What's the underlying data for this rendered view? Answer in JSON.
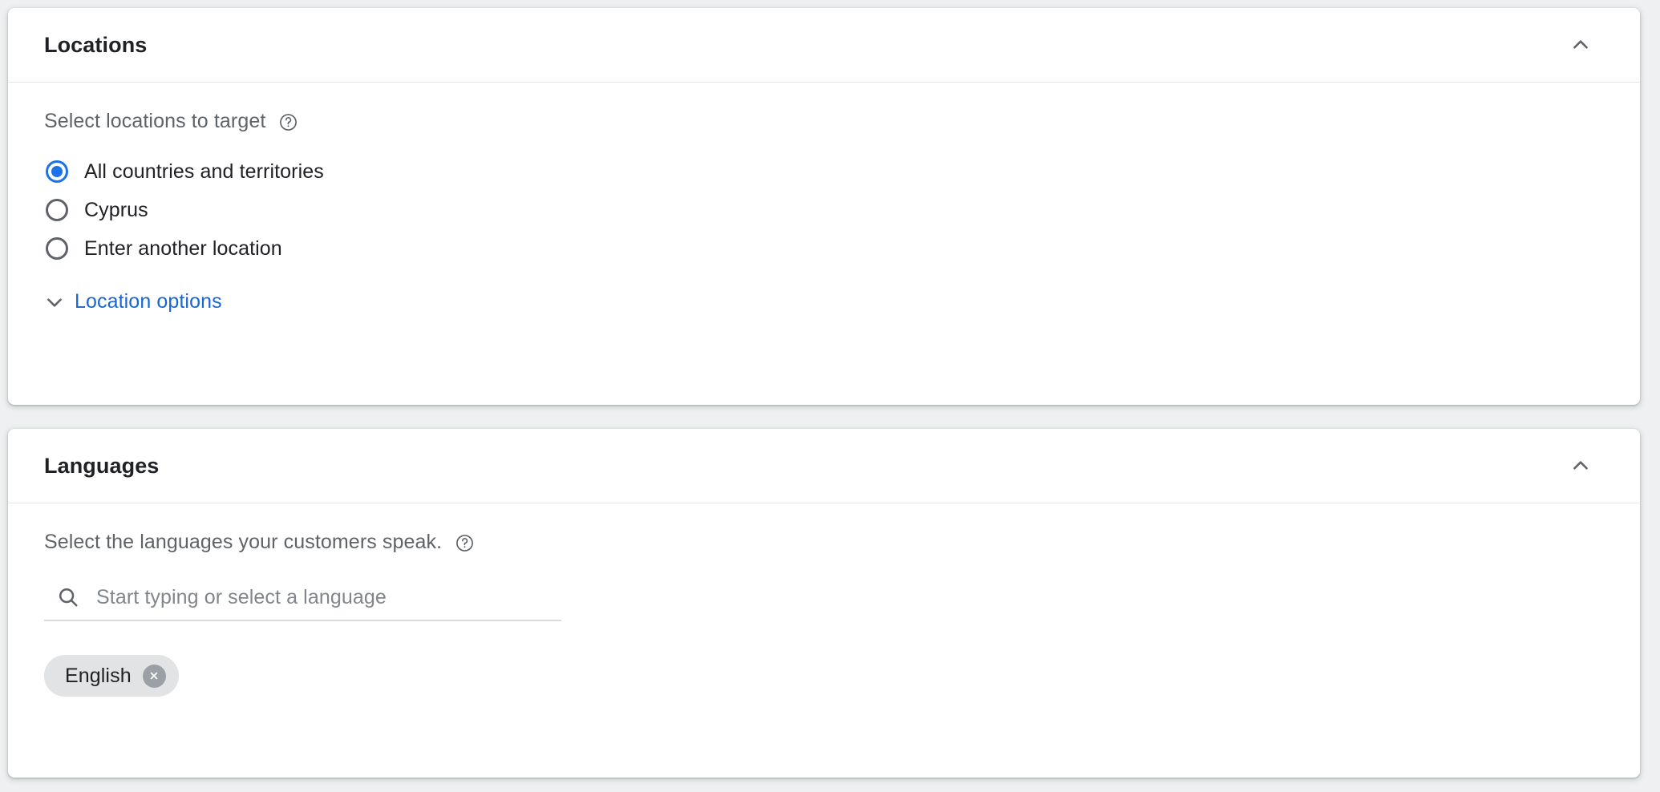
{
  "cards": [
    {
      "id": "locations",
      "title": "Locations",
      "collapse_icon": "chevron-up-icon",
      "section_label": "Select locations to target",
      "help_icon": "help-circle-icon",
      "radio_options": [
        {
          "label": "All countries and territories",
          "selected": true
        },
        {
          "label": "Cyprus",
          "selected": false
        },
        {
          "label": "Enter another location",
          "selected": false
        }
      ],
      "expander_link": {
        "icon": "chevron-down-icon",
        "label": "Location options"
      }
    },
    {
      "id": "languages",
      "title": "Languages",
      "collapse_icon": "chevron-up-icon",
      "section_label": "Select the languages your customers speak.",
      "help_icon": "help-circle-icon",
      "search": {
        "icon": "search-icon",
        "placeholder": "Start typing or select a language",
        "value": ""
      },
      "chips": [
        {
          "label": "English",
          "remove_icon": "close-circle-icon"
        }
      ]
    }
  ],
  "colors": {
    "accent_blue": "#1a73e8",
    "link_blue": "#1967d2",
    "text_primary": "#202124",
    "text_secondary": "#5f6368",
    "page_background": "#eef0f1",
    "card_background": "#ffffff",
    "chip_background": "#e1e3e4",
    "chip_remove": "#9aa0a6",
    "divider": "#e4e6e8"
  }
}
